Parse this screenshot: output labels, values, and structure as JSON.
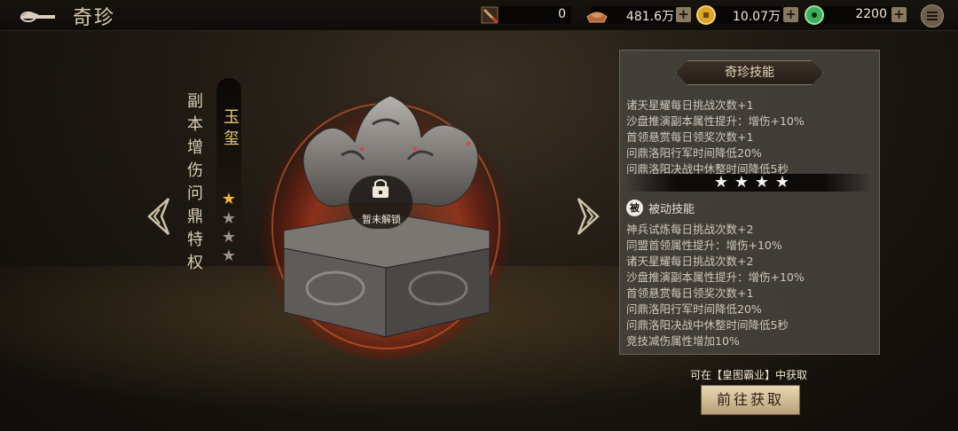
{
  "header": {
    "title": "奇珍",
    "resources": [
      {
        "icon": "shovel-item-icon",
        "value": "0"
      },
      {
        "icon": "ingot-icon",
        "value": "481.6万"
      },
      {
        "icon": "gold-coin-icon",
        "value": "10.07万"
      },
      {
        "icon": "jade-icon",
        "value": "2200"
      }
    ]
  },
  "treasure": {
    "name": "玉玺",
    "bonus_label": "副本增伤问鼎特权",
    "stars_filled": 1,
    "stars_total": 4,
    "lock_text": "暂未解锁"
  },
  "skills_panel": {
    "title": "奇珍技能",
    "active_lines": [
      "同盟首领属性提升：增伤+10%",
      "诸天星耀每日挑战次数+1",
      "沙盘推演副本属性提升：增伤+10%",
      "首领悬赏每日领奖次数+1",
      "问鼎洛阳行军时间降低20%",
      "问鼎洛阳决战中休整时间降低5秒"
    ],
    "star_tier": 4,
    "passive_badge": "被",
    "passive_label": "被动技能",
    "passive_lines": [
      "神兵试炼每日挑战次数+2",
      "同盟首领属性提升：增伤+10%",
      "诸天星耀每日挑战次数+2",
      "沙盘推演副本属性提升：增伤+10%",
      "首领悬赏每日领奖次数+1",
      "问鼎洛阳行军时间降低20%",
      "问鼎洛阳决战中休整时间降低5秒",
      "竞技减伤属性增加10%"
    ]
  },
  "source": {
    "text": "可在【皇图霸业】中获取",
    "button": "前往获取"
  },
  "colors": {
    "gold_star": "#f2b436",
    "empty_star": "#9d8f86",
    "fire_glow": "#e0401f"
  }
}
